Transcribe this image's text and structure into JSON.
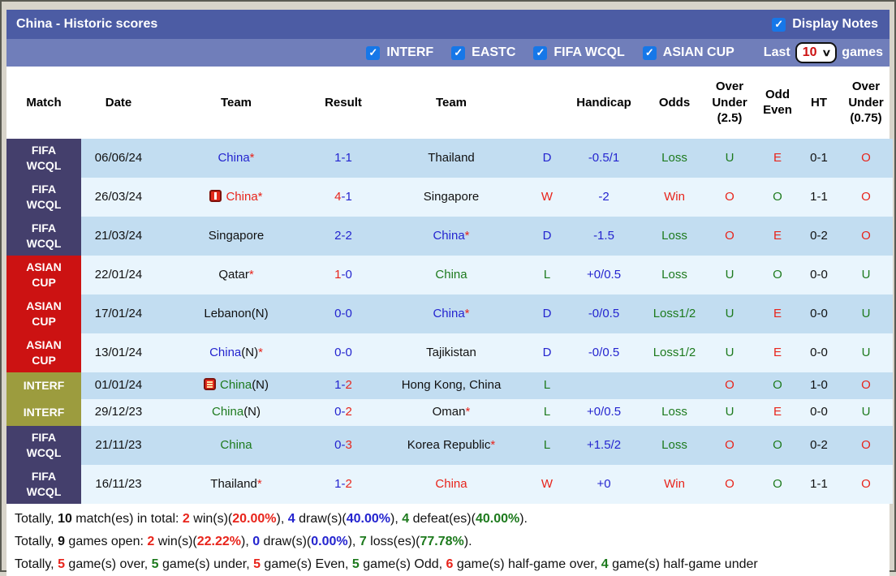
{
  "colors": {
    "title_bar_bg": "#4c5ca4",
    "filter_bar_bg": "#707eba",
    "checkbox_blue": "#1677e8",
    "row_dark": "#c2ddf1",
    "row_light": "#e9f5fd",
    "badge_fifa_wcql": "#443f6c",
    "badge_asian_cup": "#cc1212",
    "badge_interf": "#9c9c3e",
    "text_blue": "#2424cf",
    "text_red": "#e8241b",
    "text_green": "#1d7a1d"
  },
  "title_bar": {
    "title": "China - Historic scores",
    "display_notes_label": "Display Notes"
  },
  "filter_bar": {
    "filters": [
      "INTERF",
      "EASTC",
      "FIFA WCQL",
      "ASIAN CUP"
    ],
    "last_label": "Last",
    "games_count": "10",
    "games_label": "games"
  },
  "table": {
    "headers": [
      "Match",
      "Date",
      "Team",
      "Result",
      "Team",
      "",
      "Handicap",
      "Odds",
      "Over Under (2.5)",
      "Odd Even",
      "HT",
      "Over Under (0.75)"
    ],
    "rows": [
      {
        "comp": "FIFA WCQL",
        "comp_class": "fifa",
        "date": "06/06/24",
        "home": {
          "name": "China",
          "suffix": "",
          "star": true,
          "color": "blue",
          "icon": ""
        },
        "score": {
          "home": "1",
          "away": "1",
          "home_color": "blue",
          "away_color": "blue"
        },
        "away": {
          "name": "Thailand",
          "suffix": "",
          "star": false,
          "color": "black"
        },
        "wdl": {
          "text": "D",
          "color": "blue"
        },
        "handicap": "-0.5/1",
        "odds": {
          "text": "Loss",
          "color": "green"
        },
        "ou25": {
          "text": "U",
          "color": "green"
        },
        "oddeven": {
          "text": "E",
          "color": "red"
        },
        "ht": "0-1",
        "ou075": {
          "text": "O",
          "color": "red"
        }
      },
      {
        "comp": "FIFA WCQL",
        "comp_class": "fifa",
        "date": "26/03/24",
        "home": {
          "name": "China",
          "suffix": "",
          "star": true,
          "color": "red",
          "icon": "bar"
        },
        "score": {
          "home": "4",
          "away": "1",
          "home_color": "red",
          "away_color": "blue"
        },
        "away": {
          "name": "Singapore",
          "suffix": "",
          "star": false,
          "color": "black"
        },
        "wdl": {
          "text": "W",
          "color": "red"
        },
        "handicap": "-2",
        "odds": {
          "text": "Win",
          "color": "red"
        },
        "ou25": {
          "text": "O",
          "color": "red"
        },
        "oddeven": {
          "text": "O",
          "color": "green"
        },
        "ht": "1-1",
        "ou075": {
          "text": "O",
          "color": "red"
        }
      },
      {
        "comp": "FIFA WCQL",
        "comp_class": "fifa",
        "date": "21/03/24",
        "home": {
          "name": "Singapore",
          "suffix": "",
          "star": false,
          "color": "black",
          "icon": ""
        },
        "score": {
          "home": "2",
          "away": "2",
          "home_color": "blue",
          "away_color": "blue"
        },
        "away": {
          "name": "China",
          "suffix": "",
          "star": true,
          "color": "blue"
        },
        "wdl": {
          "text": "D",
          "color": "blue"
        },
        "handicap": "-1.5",
        "odds": {
          "text": "Loss",
          "color": "green"
        },
        "ou25": {
          "text": "O",
          "color": "red"
        },
        "oddeven": {
          "text": "E",
          "color": "red"
        },
        "ht": "0-2",
        "ou075": {
          "text": "O",
          "color": "red"
        }
      },
      {
        "comp": "ASIAN CUP",
        "comp_class": "asian",
        "date": "22/01/24",
        "home": {
          "name": "Qatar",
          "suffix": "",
          "star": true,
          "color": "black",
          "icon": ""
        },
        "score": {
          "home": "1",
          "away": "0",
          "home_color": "red",
          "away_color": "blue"
        },
        "away": {
          "name": "China",
          "suffix": "",
          "star": false,
          "color": "green"
        },
        "wdl": {
          "text": "L",
          "color": "green"
        },
        "handicap": "+0/0.5",
        "odds": {
          "text": "Loss",
          "color": "green"
        },
        "ou25": {
          "text": "U",
          "color": "green"
        },
        "oddeven": {
          "text": "O",
          "color": "green"
        },
        "ht": "0-0",
        "ou075": {
          "text": "U",
          "color": "green"
        }
      },
      {
        "comp": "ASIAN CUP",
        "comp_class": "asian",
        "date": "17/01/24",
        "home": {
          "name": "Lebanon",
          "suffix": "(N)",
          "star": false,
          "color": "black",
          "icon": ""
        },
        "score": {
          "home": "0",
          "away": "0",
          "home_color": "blue",
          "away_color": "blue"
        },
        "away": {
          "name": "China",
          "suffix": "",
          "star": true,
          "color": "blue"
        },
        "wdl": {
          "text": "D",
          "color": "blue"
        },
        "handicap": "-0/0.5",
        "odds": {
          "text": "Loss1/2",
          "color": "green"
        },
        "ou25": {
          "text": "U",
          "color": "green"
        },
        "oddeven": {
          "text": "E",
          "color": "red"
        },
        "ht": "0-0",
        "ou075": {
          "text": "U",
          "color": "green"
        }
      },
      {
        "comp": "ASIAN CUP",
        "comp_class": "asian",
        "date": "13/01/24",
        "home": {
          "name": "China",
          "suffix": "(N)",
          "star": true,
          "color": "blue",
          "icon": ""
        },
        "score": {
          "home": "0",
          "away": "0",
          "home_color": "blue",
          "away_color": "blue"
        },
        "away": {
          "name": "Tajikistan",
          "suffix": "",
          "star": false,
          "color": "black"
        },
        "wdl": {
          "text": "D",
          "color": "blue"
        },
        "handicap": "-0/0.5",
        "odds": {
          "text": "Loss1/2",
          "color": "green"
        },
        "ou25": {
          "text": "U",
          "color": "green"
        },
        "oddeven": {
          "text": "E",
          "color": "red"
        },
        "ht": "0-0",
        "ou075": {
          "text": "U",
          "color": "green"
        }
      },
      {
        "comp": "INTERF",
        "comp_class": "interf",
        "date": "01/01/24",
        "home": {
          "name": "China",
          "suffix": "(N)",
          "star": false,
          "color": "green",
          "icon": "lines"
        },
        "score": {
          "home": "1",
          "away": "2",
          "home_color": "blue",
          "away_color": "red"
        },
        "away": {
          "name": "Hong Kong, China",
          "suffix": "",
          "star": false,
          "color": "black"
        },
        "wdl": {
          "text": "L",
          "color": "green"
        },
        "handicap": "",
        "odds": {
          "text": "",
          "color": "green"
        },
        "ou25": {
          "text": "O",
          "color": "red"
        },
        "oddeven": {
          "text": "O",
          "color": "green"
        },
        "ht": "1-0",
        "ou075": {
          "text": "O",
          "color": "red"
        }
      },
      {
        "comp": "INTERF",
        "comp_class": "interf",
        "date": "29/12/23",
        "home": {
          "name": "China",
          "suffix": "(N)",
          "star": false,
          "color": "green",
          "icon": ""
        },
        "score": {
          "home": "0",
          "away": "2",
          "home_color": "blue",
          "away_color": "red"
        },
        "away": {
          "name": "Oman",
          "suffix": "",
          "star": true,
          "color": "black"
        },
        "wdl": {
          "text": "L",
          "color": "green"
        },
        "handicap": "+0/0.5",
        "odds": {
          "text": "Loss",
          "color": "green"
        },
        "ou25": {
          "text": "U",
          "color": "green"
        },
        "oddeven": {
          "text": "E",
          "color": "red"
        },
        "ht": "0-0",
        "ou075": {
          "text": "U",
          "color": "green"
        }
      },
      {
        "comp": "FIFA WCQL",
        "comp_class": "fifa",
        "date": "21/11/23",
        "home": {
          "name": "China",
          "suffix": "",
          "star": false,
          "color": "green",
          "icon": ""
        },
        "score": {
          "home": "0",
          "away": "3",
          "home_color": "blue",
          "away_color": "red"
        },
        "away": {
          "name": "Korea Republic",
          "suffix": "",
          "star": true,
          "color": "black"
        },
        "wdl": {
          "text": "L",
          "color": "green"
        },
        "handicap": "+1.5/2",
        "odds": {
          "text": "Loss",
          "color": "green"
        },
        "ou25": {
          "text": "O",
          "color": "red"
        },
        "oddeven": {
          "text": "O",
          "color": "green"
        },
        "ht": "0-2",
        "ou075": {
          "text": "O",
          "color": "red"
        }
      },
      {
        "comp": "FIFA WCQL",
        "comp_class": "fifa",
        "date": "16/11/23",
        "home": {
          "name": "Thailand",
          "suffix": "",
          "star": true,
          "color": "black",
          "icon": ""
        },
        "score": {
          "home": "1",
          "away": "2",
          "home_color": "blue",
          "away_color": "red"
        },
        "away": {
          "name": "China",
          "suffix": "",
          "star": false,
          "color": "red"
        },
        "wdl": {
          "text": "W",
          "color": "red"
        },
        "handicap": "+0",
        "odds": {
          "text": "Win",
          "color": "red"
        },
        "ou25": {
          "text": "O",
          "color": "red"
        },
        "oddeven": {
          "text": "O",
          "color": "green"
        },
        "ht": "1-1",
        "ou075": {
          "text": "O",
          "color": "red"
        }
      }
    ]
  },
  "summary": {
    "lines": [
      [
        {
          "t": "Totally, ",
          "c": "black"
        },
        {
          "t": "10",
          "c": "black",
          "b": true
        },
        {
          "t": " match(es) in total: ",
          "c": "black"
        },
        {
          "t": "2",
          "c": "red",
          "b": true
        },
        {
          "t": " win(s)(",
          "c": "black"
        },
        {
          "t": "20.00%",
          "c": "red",
          "b": true
        },
        {
          "t": "), ",
          "c": "black"
        },
        {
          "t": "4",
          "c": "blue",
          "b": true
        },
        {
          "t": " draw(s)(",
          "c": "black"
        },
        {
          "t": "40.00%",
          "c": "blue",
          "b": true
        },
        {
          "t": "), ",
          "c": "black"
        },
        {
          "t": "4",
          "c": "green",
          "b": true
        },
        {
          "t": " defeat(es)(",
          "c": "black"
        },
        {
          "t": "40.00%",
          "c": "green",
          "b": true
        },
        {
          "t": ").",
          "c": "black"
        }
      ],
      [
        {
          "t": "Totally, ",
          "c": "black"
        },
        {
          "t": "9",
          "c": "black",
          "b": true
        },
        {
          "t": " games open: ",
          "c": "black"
        },
        {
          "t": "2",
          "c": "red",
          "b": true
        },
        {
          "t": " win(s)(",
          "c": "black"
        },
        {
          "t": "22.22%",
          "c": "red",
          "b": true
        },
        {
          "t": "), ",
          "c": "black"
        },
        {
          "t": "0",
          "c": "blue",
          "b": true
        },
        {
          "t": " draw(s)(",
          "c": "black"
        },
        {
          "t": "0.00%",
          "c": "blue",
          "b": true
        },
        {
          "t": "), ",
          "c": "black"
        },
        {
          "t": "7",
          "c": "green",
          "b": true
        },
        {
          "t": " loss(es)(",
          "c": "black"
        },
        {
          "t": "77.78%",
          "c": "green",
          "b": true
        },
        {
          "t": ").",
          "c": "black"
        }
      ],
      [
        {
          "t": "Totally, ",
          "c": "black"
        },
        {
          "t": "5",
          "c": "red",
          "b": true
        },
        {
          "t": " game(s) over, ",
          "c": "black"
        },
        {
          "t": "5",
          "c": "green",
          "b": true
        },
        {
          "t": " game(s) under, ",
          "c": "black"
        },
        {
          "t": "5",
          "c": "red",
          "b": true
        },
        {
          "t": " game(s) Even, ",
          "c": "black"
        },
        {
          "t": "5",
          "c": "green",
          "b": true
        },
        {
          "t": " game(s) Odd, ",
          "c": "black"
        },
        {
          "t": "6",
          "c": "red",
          "b": true
        },
        {
          "t": " game(s) half-game over, ",
          "c": "black"
        },
        {
          "t": "4",
          "c": "green",
          "b": true
        },
        {
          "t": " game(s) half-game under",
          "c": "black"
        }
      ]
    ]
  }
}
